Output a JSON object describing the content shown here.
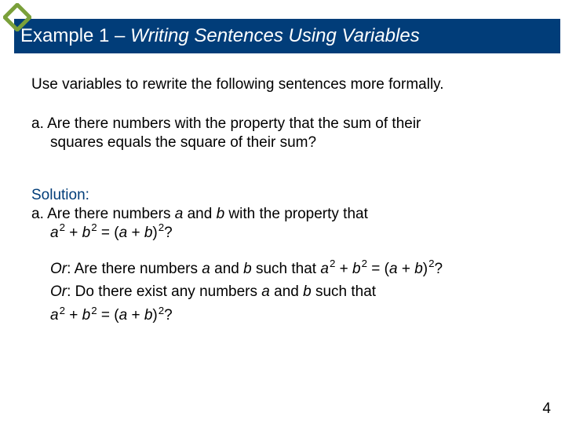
{
  "title": {
    "prefix": "Example 1 – ",
    "italic": "Writing Sentences Using Variables"
  },
  "intro": "Use variables to rewrite the following sentences more formally.",
  "question": {
    "label": "a.",
    "line1": " Are there numbers with the property that the sum of their",
    "line2": "squares equals the square of their sum?"
  },
  "solution_label": "Solution:",
  "answer": {
    "label": "a.",
    "pre": " Are there numbers ",
    "a": "a",
    "mid1": " and ",
    "b": "b",
    "post1": " with the property that",
    "eq": {
      "a_sq": "a",
      "sup": "2",
      "plus": " + ",
      "b_sq": "b",
      "eq": " = (",
      "ab": "a",
      "plus2": " + ",
      "b2": "b",
      "close": ")",
      "q": "?"
    }
  },
  "or1": {
    "or": "Or",
    "colon": ": Are there numbers ",
    "a": "a",
    "and": " and ",
    "b": "b",
    "such": " such that ",
    "q": "?"
  },
  "or2": {
    "or": "Or",
    "colon": ": Do there exist any numbers ",
    "a": "a",
    "and": " and ",
    "b": "b",
    "such": " such that",
    "q": "?"
  },
  "eq_parts": {
    "a": "a",
    "b": "b",
    "sup2": "2",
    "plus": " + ",
    "eq_open": " = (",
    "close_paren": ")"
  },
  "page": "4"
}
